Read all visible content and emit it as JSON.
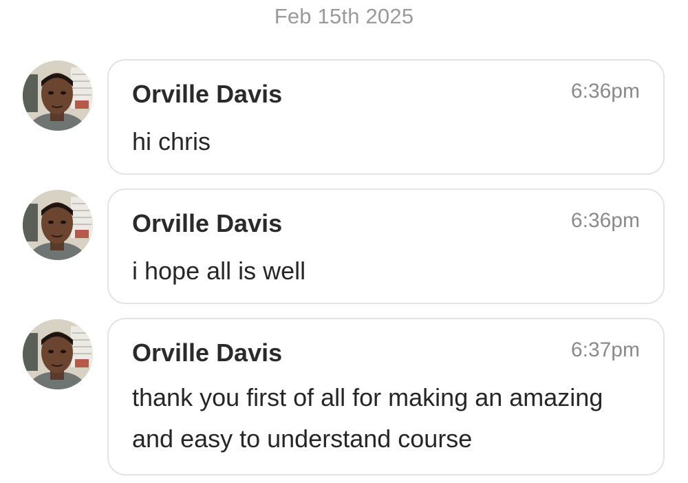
{
  "date_separator": "Feb 15th 2025",
  "messages": [
    {
      "sender": "Orville Davis",
      "time": "6:36pm",
      "text": "hi chris",
      "avatar": "profile-photo"
    },
    {
      "sender": "Orville Davis",
      "time": "6:36pm",
      "text": "i hope all is well",
      "avatar": "profile-photo"
    },
    {
      "sender": "Orville Davis",
      "time": "6:37pm",
      "text": "thank you first of all for making an amazing and easy to understand course",
      "avatar": "profile-photo"
    }
  ]
}
